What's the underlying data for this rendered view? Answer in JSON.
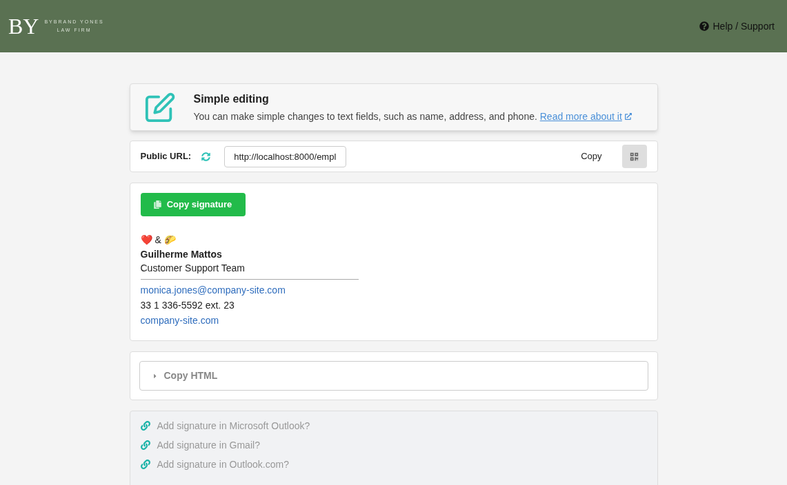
{
  "header": {
    "logo": {
      "monogram": "BY",
      "name": "BYBRAND YONES",
      "tagline": "LAW FIRM"
    },
    "help_link": "Help / Support"
  },
  "notice": {
    "title": "Simple editing",
    "text": "You can make simple changes to text fields, such as name, address, and phone.",
    "link": "Read more about it"
  },
  "public_url": {
    "label": "Public URL:",
    "value": "http://localhost:8000/empl",
    "copy_button": "Copy"
  },
  "signature": {
    "copy_button": "Copy signature",
    "tagline": "❤️ & 🌮",
    "name": "Guilherme Mattos",
    "team": "Customer Support Team",
    "email": "monica.jones@company-site.com",
    "phone": "33 1 336-5592 ext. 23",
    "website": "company-site.com"
  },
  "copy_html": {
    "label": "Copy HTML",
    "expanded": false
  },
  "help_links": [
    "Add signature in Microsoft Outlook?",
    "Add signature in Gmail?",
    "Add signature in Outlook.com?"
  ]
}
